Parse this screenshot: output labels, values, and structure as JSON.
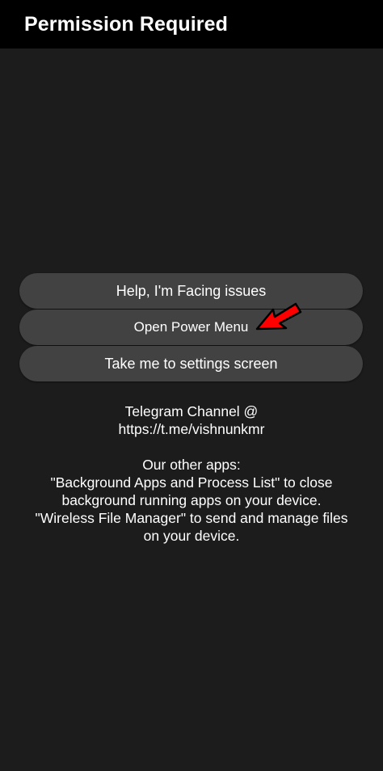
{
  "app_bar": {
    "title": "Permission Required"
  },
  "buttons": {
    "help": "Help, I'm Facing issues",
    "power_menu": "Open Power Menu",
    "settings": "Take me to settings screen"
  },
  "info": {
    "telegram_line1": "Telegram Channel @",
    "telegram_line2": "https://t.me/vishnunkmr",
    "other_apps_heading": "Our other apps:",
    "other_apps_line1": "\"Background Apps and Process List\" to close",
    "other_apps_line2": "background running apps on your device.",
    "other_apps_line3": "\"Wireless File Manager\" to send and manage files",
    "other_apps_line4": "on your device."
  },
  "colors": {
    "background": "#1c1c1c",
    "app_bar": "#000000",
    "button": "#424242",
    "arrow": "#ff0000"
  },
  "icons": {
    "pointer": "red-arrow-icon"
  }
}
